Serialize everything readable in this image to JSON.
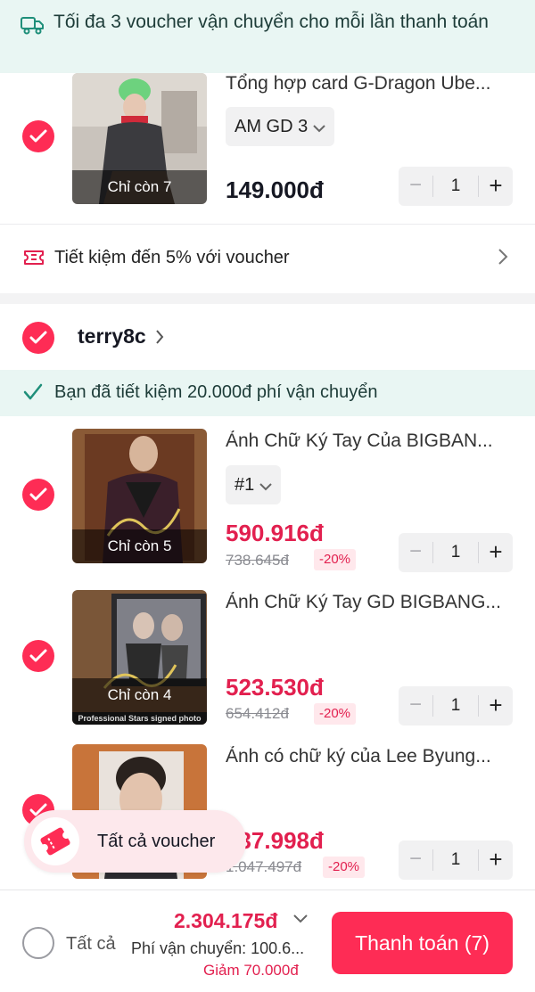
{
  "banner": {
    "text": "Tối đa 3 voucher vận chuyển cho mỗi lần thanh toán"
  },
  "item1": {
    "title": "Tổng hợp card G-Dragon Ube...",
    "stock": "Chỉ còn 7",
    "variant": "AM GD 3",
    "price": "149.000đ",
    "qty": "1"
  },
  "voucher_row": {
    "label": "Tiết kiệm đến 5% với voucher"
  },
  "shop": {
    "name": "terry8c"
  },
  "saved": {
    "text": "Bạn đã tiết kiệm 20.000đ phí vận chuyển"
  },
  "item2": {
    "title": "Ảnh Chữ Ký Tay Của BIGBAN...",
    "stock": "Chỉ còn 5",
    "variant": "#1",
    "price": "590.916đ",
    "old_price": "738.645đ",
    "discount": "-20%",
    "qty": "1"
  },
  "item3": {
    "title": "Ảnh Chữ Ký Tay GD BIGBANG...",
    "stock": "Chỉ còn 4",
    "caption": "Professional Stars signed photo",
    "price": "523.530đ",
    "old_price": "654.412đ",
    "discount": "-20%",
    "qty": "1"
  },
  "item4": {
    "title": "Ảnh có chữ ký của Lee Byung...",
    "price": "837.998đ",
    "old_price": "1.047.497đ",
    "discount": "-20%",
    "qty": "1"
  },
  "voucher_pill": {
    "label": "Tất cả voucher"
  },
  "bottom": {
    "select_all": "Tất cả",
    "total": "2.304.175đ",
    "shipping": "Phí vận chuyển: 100.6...",
    "reduction": "Giảm 70.000đ",
    "checkout": "Thanh toán (7)"
  },
  "colors": {
    "accent": "#fe2c55",
    "price_red": "#e2204f",
    "banner_bg": "#e9f6f3"
  }
}
